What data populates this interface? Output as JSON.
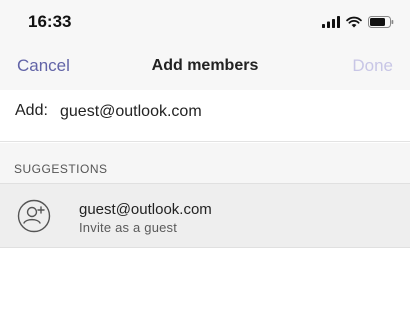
{
  "status_bar": {
    "time": "16:33",
    "icons": [
      "cellular-signal-icon",
      "wifi-icon",
      "battery-icon"
    ]
  },
  "nav": {
    "cancel_label": "Cancel",
    "title": "Add members",
    "done_label": "Done"
  },
  "add": {
    "label": "Add:",
    "value": "guest@outlook.com"
  },
  "suggestions": {
    "title": "SUGGESTIONS",
    "items": [
      {
        "icon": "add-guest-icon",
        "primary": "guest@outlook.com",
        "secondary": "Invite as a guest"
      }
    ]
  },
  "colors": {
    "accent": "#6264a7",
    "accent_disabled": "#c8c6e6",
    "bar_background": "#f7f7f7",
    "row_highlight": "#eeeeee"
  }
}
